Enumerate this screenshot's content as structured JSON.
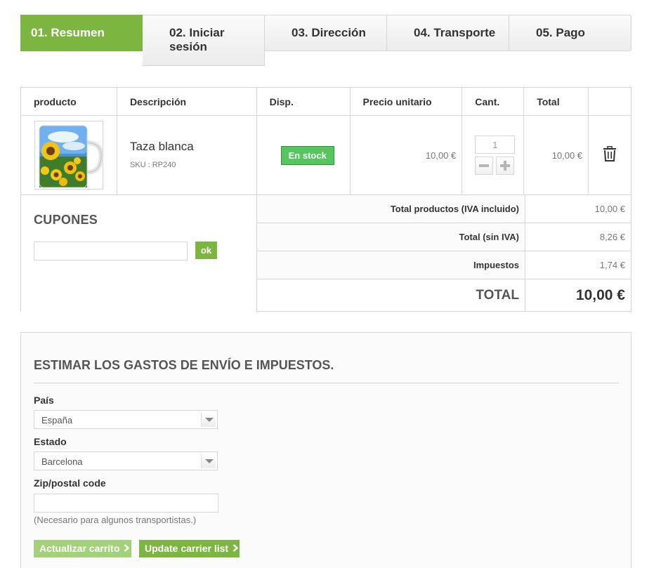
{
  "steps": [
    {
      "label": "01. Resumen"
    },
    {
      "label": "02. Iniciar sesión"
    },
    {
      "label": "03. Dirección"
    },
    {
      "label": "04. Transporte"
    },
    {
      "label": "05. Pago"
    }
  ],
  "cart": {
    "headers": {
      "product": "producto",
      "description": "Descripción",
      "availability": "Disp.",
      "unit_price": "Precio unitario",
      "quantity": "Cant.",
      "total": "Total"
    },
    "item": {
      "name": "Taza blanca",
      "sku": "SKU : RP240",
      "stock": "En stock",
      "unit_price": "10,00 €",
      "quantity": "1",
      "total": "10,00 €"
    }
  },
  "coupons": {
    "title": "CUPONES",
    "ok_label": "ok"
  },
  "summary": {
    "products_label": "Total productos (IVA incluido)",
    "products_value": "10,00 €",
    "net_label": "Total (sin IVA)",
    "net_value": "8,26 €",
    "tax_label": "Impuestos",
    "tax_value": "1,74 €",
    "total_label": "TOTAL",
    "total_value": "10,00 €"
  },
  "shipping": {
    "title": "ESTIMAR LOS GASTOS DE ENVÍO E IMPUESTOS.",
    "country_label": "País",
    "country_value": "España",
    "state_label": "Estado",
    "state_value": "Barcelona",
    "zip_label": "Zip/postal code",
    "zip_note": "(Necesario para algunos transportistas.)",
    "update_cart_label": "Actualizar carrito",
    "update_carrier_label": "Update carrier list"
  },
  "colors": {
    "accent": "#7cb641",
    "stock": "#55c65e"
  }
}
